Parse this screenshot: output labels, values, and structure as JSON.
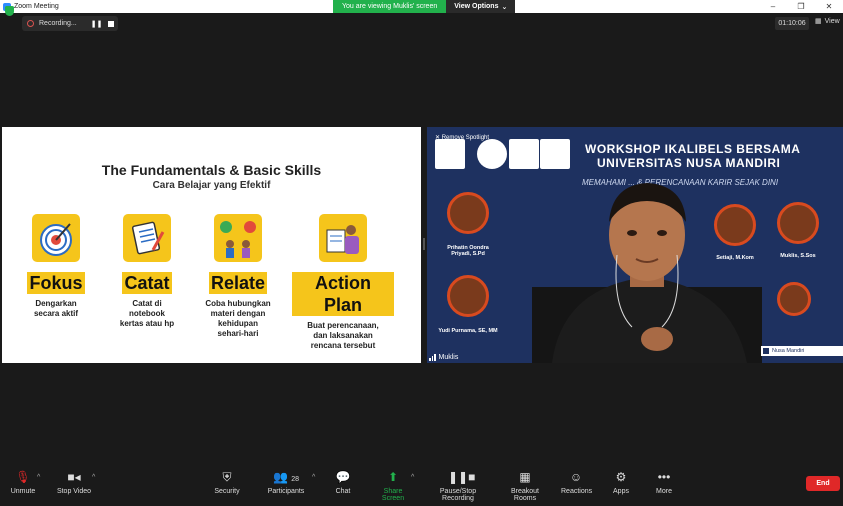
{
  "window": {
    "title": "Zoom Meeting"
  },
  "banner": {
    "viewing": "You are viewing Muklis' screen",
    "view_options": "View Options"
  },
  "recording": {
    "label": "Recording..."
  },
  "timer": "01:10:06",
  "view_button": "View",
  "slide": {
    "title": "The Fundamentals & Basic Skills",
    "subtitle": "Cara Belajar yang Efektif",
    "columns": [
      {
        "title": "Fokus",
        "desc1": "Dengarkan",
        "desc2": "secara aktif",
        "desc3": "",
        "desc4": ""
      },
      {
        "title": "Catat",
        "desc1": "Catat di",
        "desc2": "notebook",
        "desc3": "kertas atau hp",
        "desc4": ""
      },
      {
        "title": "Relate",
        "desc1": "Coba hubungkan",
        "desc2": "materi dengan",
        "desc3": "kehidupan",
        "desc4": "sehari-hari"
      },
      {
        "title": "Action Plan",
        "desc1": "Buat perencanaan,",
        "desc2": "dan laksanakan",
        "desc3": "rencana tersebut",
        "desc4": ""
      }
    ]
  },
  "video": {
    "spotlight": "Remove Spotlight",
    "title1": "WORKSHOP IKALIBELS BERSAMA",
    "title2": "UNIVERSITAS NUSA MANDIRI",
    "subtitle": "MEMAHAMI ... & PERENCANAAN KARIR SEJAK DINI",
    "speakers": [
      {
        "name": "Prihatin Oondra Priyadi, S.Pd"
      },
      {
        "name": "Yudi Purnama, SE, MM"
      },
      {
        "name": "Setiaji, M.Kom"
      },
      {
        "name": "Muklis, S.Sos"
      }
    ],
    "participant_name": "Muklis",
    "brand_strip": "Nusa Mandiri"
  },
  "toolbar": {
    "unmute": "Unmute",
    "stop_video": "Stop Video",
    "security": "Security",
    "participants": "Participants",
    "participants_count": "28",
    "chat": "Chat",
    "share_screen": "Share Screen",
    "pause_recording": "Pause/Stop Recording",
    "breakout": "Breakout Rooms",
    "reactions": "Reactions",
    "apps": "Apps",
    "more": "More",
    "end": "End"
  },
  "colors": {
    "accent_yellow": "#f5c51b",
    "zoom_green": "#22b14c",
    "end_red": "#e02828",
    "poster_navy": "#1e3160"
  }
}
